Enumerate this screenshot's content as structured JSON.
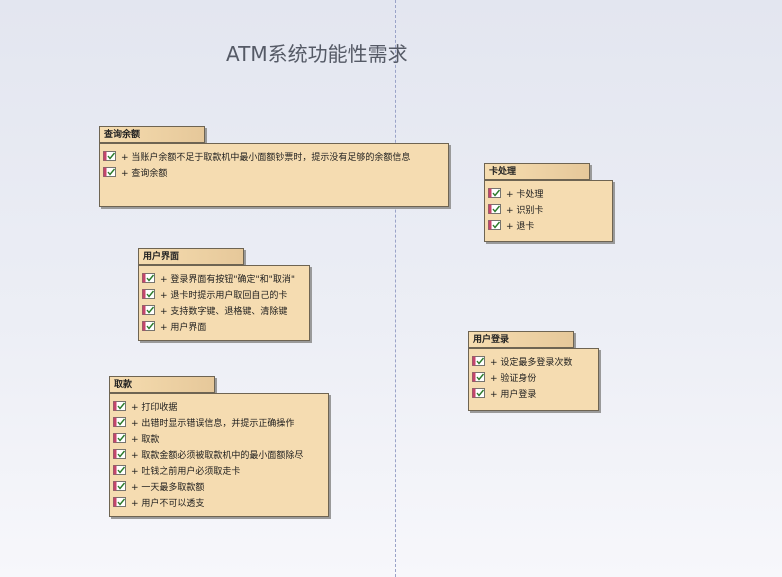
{
  "title": "ATM系统功能性需求",
  "packages": [
    {
      "name": "查询余额",
      "items": [
        "+ 当账户余额不足于取款机中最小面额钞票时，提示没有足够的余额信息",
        "+ 查询余额"
      ]
    },
    {
      "name": "卡处理",
      "items": [
        "+ 卡处理",
        "+ 识别卡",
        "+ 退卡"
      ]
    },
    {
      "name": "用户界面",
      "items": [
        "+ 登录界面有按钮\"确定\"和\"取消\"",
        "+ 退卡时提示用户取回自己的卡",
        "+ 支持数字键、退格键、清除键",
        "+ 用户界面"
      ]
    },
    {
      "name": "用户登录",
      "items": [
        "+ 设定最多登录次数",
        "+ 验证身份",
        "+ 用户登录"
      ]
    },
    {
      "name": "取款",
      "items": [
        "+ 打印收据",
        "+ 出错时显示错误信息，并提示正确操作",
        "+ 取款",
        "+ 取款金额必须被取款机中的最小面额除尽",
        "+ 吐钱之前用户必须取走卡",
        "+ 一天最多取款额",
        "+ 用户不可以透支"
      ]
    }
  ],
  "icon": "requirement-check-icon",
  "colors": {
    "package_fill": "#f5dcb1",
    "tab_fill": "#e6c89a",
    "border": "#6e6452",
    "check": "#2a7a2a",
    "marker": "#c4456b"
  }
}
